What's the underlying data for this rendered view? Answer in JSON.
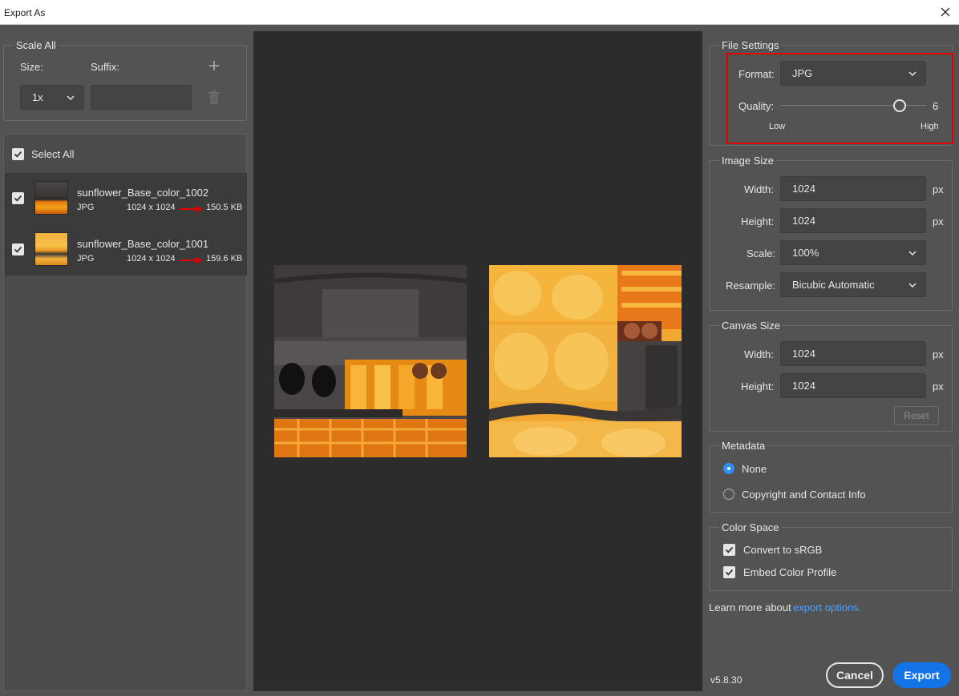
{
  "window": {
    "title": "Export As"
  },
  "scale_all": {
    "title": "Scale All",
    "size_label": "Size:",
    "suffix_label": "Suffix:",
    "size_value": "1x",
    "suffix_value": ""
  },
  "file_list": {
    "select_all_label": "Select All",
    "files": [
      {
        "name": "sunflower_Base_color_1002",
        "format": "JPG",
        "dimensions": "1024 x 1024",
        "size": "150.5 KB",
        "checked": true
      },
      {
        "name": "sunflower_Base_color_1001",
        "format": "JPG",
        "dimensions": "1024 x 1024",
        "size": "159.6 KB",
        "checked": true
      }
    ]
  },
  "file_settings": {
    "title": "File Settings",
    "format_label": "Format:",
    "format_value": "JPG",
    "quality_label": "Quality:",
    "quality_value": "6",
    "quality_fraction": 0.85,
    "low_label": "Low",
    "high_label": "High"
  },
  "image_size": {
    "title": "Image Size",
    "width_label": "Width:",
    "width_value": "1024",
    "height_label": "Height:",
    "height_value": "1024",
    "unit": "px",
    "scale_label": "Scale:",
    "scale_value": "100%",
    "resample_label": "Resample:",
    "resample_value": "Bicubic Automatic"
  },
  "canvas_size": {
    "title": "Canvas Size",
    "width_label": "Width:",
    "width_value": "1024",
    "height_label": "Height:",
    "height_value": "1024",
    "unit": "px",
    "reset_label": "Reset"
  },
  "metadata": {
    "title": "Metadata",
    "options": [
      "None",
      "Copyright and Contact Info"
    ],
    "selected": "None"
  },
  "color_space": {
    "title": "Color Space",
    "convert_label": "Convert to sRGB",
    "embed_label": "Embed Color Profile",
    "convert_checked": true,
    "embed_checked": true
  },
  "footer": {
    "learn_more_text": "Learn more about",
    "learn_more_link": "export options.",
    "version": "v5.8.30",
    "cancel_label": "Cancel",
    "export_label": "Export"
  },
  "colors": {
    "accent": "#1473e6",
    "link": "#4ba3ff",
    "annotation": "#e00000"
  }
}
